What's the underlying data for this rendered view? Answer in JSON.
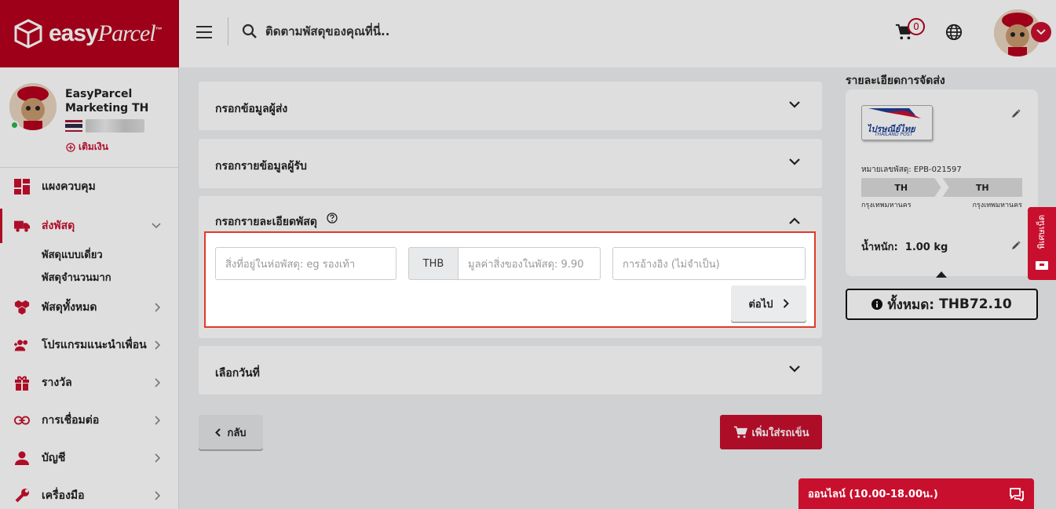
{
  "brand": {
    "logo_text": "easy",
    "logo_script": "Parcel",
    "logo_tm": "™"
  },
  "header": {
    "search_placeholder": "ติดตามพัสดุของคุณที่นี่..",
    "cart_count": "0"
  },
  "profile": {
    "name": "EasyParcel Marketing TH",
    "topup_label": "เติมเงิน"
  },
  "nav": {
    "items": [
      {
        "label": "แผงควบคุม",
        "icon": "dashboard-icon"
      },
      {
        "label": "ส่งพัสดุ",
        "icon": "truck-icon"
      },
      {
        "label": "พัสดุทั้งหมด",
        "icon": "boxes-icon"
      },
      {
        "label": "โปรแกรมแนะนำเพื่อน",
        "icon": "add-user-icon"
      },
      {
        "label": "รางวัล",
        "icon": "gift-icon"
      },
      {
        "label": "การเชื่อมต่อ",
        "icon": "link-icon"
      },
      {
        "label": "บัญชี",
        "icon": "person-icon"
      },
      {
        "label": "เครื่องมือ",
        "icon": "wrench-icon"
      }
    ],
    "sub_items": [
      "พัสดุแบบเดี่ยว",
      "พัสดุจำนวนมาก"
    ]
  },
  "form": {
    "sender_section": "กรอกข้อมูลผู้ส่ง",
    "receiver_section": "กรอกรายข้อมูลผู้รับ",
    "parcel_section": "กรอกรายละเอียดพัสดุ",
    "content_placeholder": "สิ่งที่อยู่ในห่อพัสดุ: eg รองเท้า",
    "currency": "THB",
    "value_placeholder": "มูลค่าสิ่งของในพัสดุ: 9.90",
    "reference_placeholder": "การอ้างอิง (ไม่จำเป็น)",
    "next_label": "ต่อไป",
    "date_section": "เลือกวันที่",
    "back_label": "กลับ",
    "add_cart_label": "เพิ่มใส่รถเข็น"
  },
  "summary": {
    "title": "รายละเอียดการจัดส่ง",
    "courier_logo_text": "ไปรษณีย์ไทย",
    "courier_logo_sub": "THAILAND POST",
    "parcel_no": "หมายเลขพัสดุ: EPB-021597",
    "from_country": "TH",
    "to_country": "TH",
    "from_city": "กรุงเทพมหานคร",
    "to_city": "กรุงเทพมหานคร",
    "weight_label": "น้ำหนัก:",
    "weight_value": "1.00 kg",
    "total_label": "ทั้งหมด:",
    "total_value": "THB72.10"
  },
  "side_tab": {
    "label": "พิเศษเน็ต"
  },
  "chat": {
    "label": "ออนไลน์ (10.00-18.00น.)"
  },
  "colors": {
    "brand": "#c8102e",
    "highlight": "#e03a2a"
  }
}
